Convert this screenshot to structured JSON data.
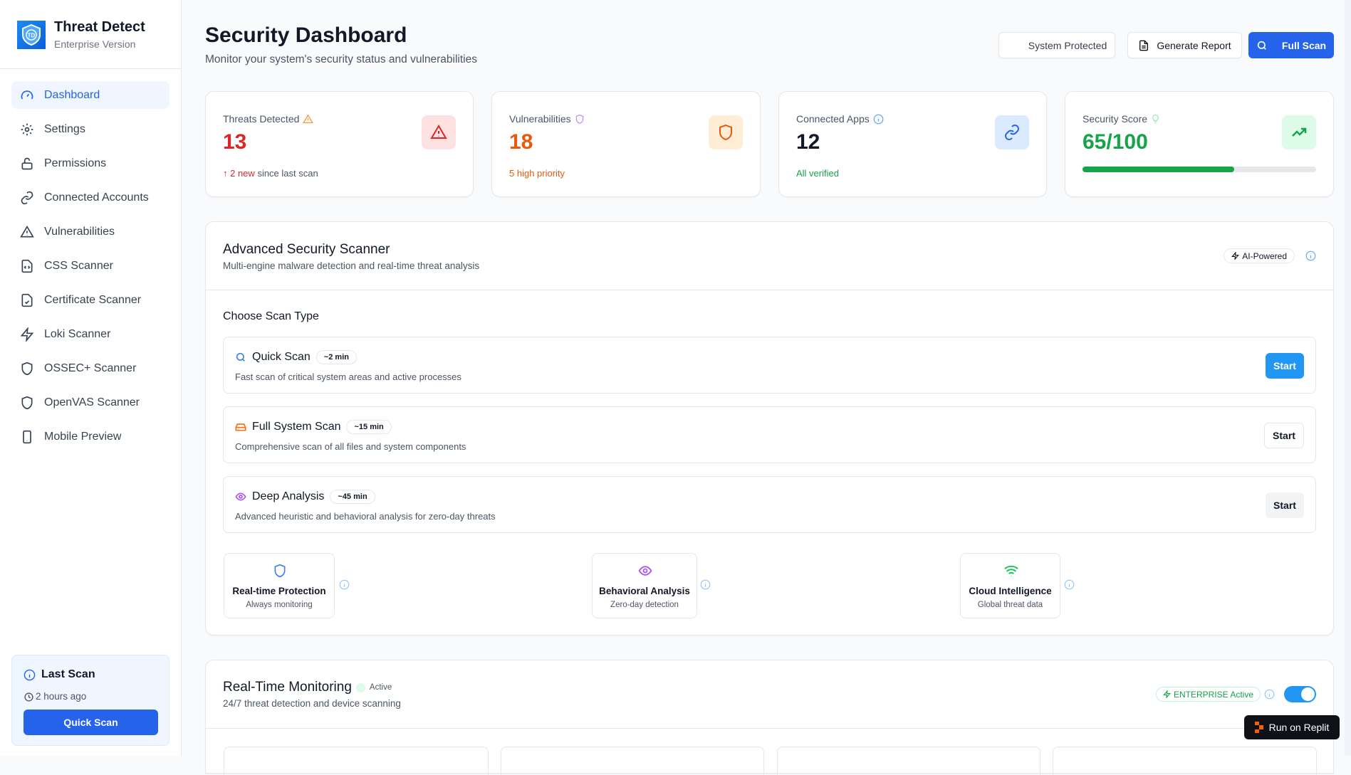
{
  "app": {
    "name": "Threat Detect",
    "edition": "Enterprise Version",
    "logo_text": "TD"
  },
  "sidebar": {
    "items": [
      {
        "label": "Dashboard",
        "icon": "gauge-icon",
        "active": true
      },
      {
        "label": "Settings",
        "icon": "gear-icon"
      },
      {
        "label": "Permissions",
        "icon": "lock-icon"
      },
      {
        "label": "Connected Accounts",
        "icon": "link-icon"
      },
      {
        "label": "Vulnerabilities",
        "icon": "warning-icon"
      },
      {
        "label": "CSS Scanner",
        "icon": "file-code-icon"
      },
      {
        "label": "Certificate Scanner",
        "icon": "file-check-icon"
      },
      {
        "label": "Loki Scanner",
        "icon": "zap-icon"
      },
      {
        "label": "OSSEC+ Scanner",
        "icon": "shield-icon"
      },
      {
        "label": "OpenVAS Scanner",
        "icon": "shield-icon"
      },
      {
        "label": "Mobile Preview",
        "icon": "phone-icon"
      }
    ],
    "last_scan": {
      "title": "Last Scan",
      "time": "2 hours ago",
      "button": "Quick Scan"
    }
  },
  "header": {
    "title": "Security Dashboard",
    "subtitle": "Monitor your system's security status and vulnerabilities",
    "status": "System Protected",
    "report_button": "Generate Report",
    "scan_button": "Full Scan"
  },
  "stats": [
    {
      "label": "Threats Detected",
      "value": "13",
      "sub_accent": "↑ 2 new",
      "sub": "since last scan",
      "color": "#dc2626"
    },
    {
      "label": "Vulnerabilities",
      "value": "18",
      "sub_accent": "5 high priority",
      "color": "#ea580c"
    },
    {
      "label": "Connected Apps",
      "value": "12",
      "sub_accent": "All verified",
      "color": "#111827"
    },
    {
      "label": "Security Score",
      "value": "65/100",
      "progress": 65,
      "color": "#16a34a"
    }
  ],
  "scanner": {
    "title": "Advanced Security Scanner",
    "subtitle": "Multi-engine malware detection and real-time threat analysis",
    "badge": "AI-Powered",
    "choose_label": "Choose Scan Type",
    "types": [
      {
        "name": "Quick Scan",
        "time": "~2 min",
        "desc": "Fast scan of critical system areas and active processes",
        "button": "Start"
      },
      {
        "name": "Full System Scan",
        "time": "~15 min",
        "desc": "Comprehensive scan of all files and system components",
        "button": "Start"
      },
      {
        "name": "Deep Analysis",
        "time": "~45 min",
        "desc": "Advanced heuristic and behavioral analysis for zero-day threats",
        "button": "Start"
      }
    ],
    "features": [
      {
        "title": "Real-time Protection",
        "sub": "Always monitoring"
      },
      {
        "title": "Behavioral Analysis",
        "sub": "Zero-day detection"
      },
      {
        "title": "Cloud Intelligence",
        "sub": "Global threat data"
      }
    ]
  },
  "monitoring": {
    "title": "Real-Time Monitoring",
    "status": "Active",
    "subtitle": "24/7 threat detection and device scanning",
    "badge": "ENTERPRISE Active",
    "toggle_on": true
  },
  "replit": {
    "label": "Run on Replit"
  }
}
